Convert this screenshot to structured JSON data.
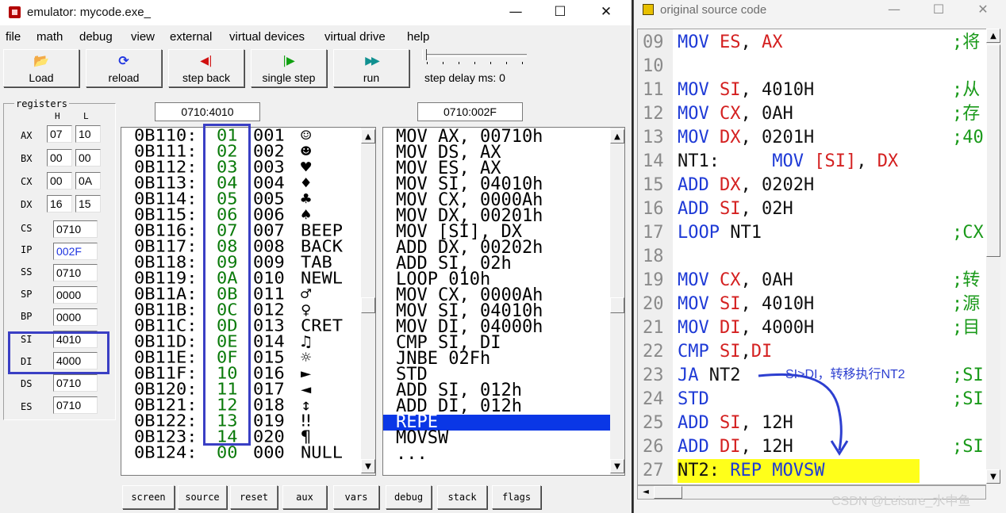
{
  "emulator": {
    "title": "emulator: mycode.exe_",
    "window_buttons": [
      "—",
      "☐",
      "✕"
    ],
    "menu": [
      "file",
      "math",
      "debug",
      "view",
      "external",
      "virtual devices",
      "virtual drive",
      "help"
    ],
    "toolbar": [
      {
        "label": "Load",
        "icon": "open-folder-icon",
        "glyph": "📂",
        "color": "#c08000"
      },
      {
        "label": "reload",
        "icon": "reload-icon",
        "glyph": "⟳",
        "color": "#1f35e0"
      },
      {
        "label": "step back",
        "icon": "step-back-icon",
        "glyph": "◀|",
        "color": "#d01010"
      },
      {
        "label": "single step",
        "icon": "single-step-icon",
        "glyph": "|▶",
        "color": "#10a010"
      },
      {
        "label": "run",
        "icon": "run-icon",
        "glyph": "▶▶",
        "color": "#109090"
      }
    ],
    "step_delay_label": "step delay ms: 0",
    "registers": {
      "title": "registers",
      "h_label": "H",
      "l_label": "L",
      "pairs": [
        {
          "name": "AX",
          "h": "07",
          "l": "10"
        },
        {
          "name": "BX",
          "h": "00",
          "l": "00"
        },
        {
          "name": "CX",
          "h": "00",
          "l": "0A"
        },
        {
          "name": "DX",
          "h": "16",
          "l": "15"
        }
      ],
      "singles": [
        {
          "name": "CS",
          "value": "0710"
        },
        {
          "name": "IP",
          "value": "002F",
          "highlight": true
        },
        {
          "name": "SS",
          "value": "0710"
        },
        {
          "name": "SP",
          "value": "0000"
        },
        {
          "name": "BP",
          "value": "0000"
        },
        {
          "name": "SI",
          "value": "4010"
        },
        {
          "name": "DI",
          "value": "4000"
        },
        {
          "name": "DS",
          "value": "0710"
        },
        {
          "name": "ES",
          "value": "0710"
        }
      ]
    },
    "memory_address": "0710:4010",
    "code_address": "0710:002F",
    "memory_rows": [
      {
        "addr": "0B110:",
        "hex": "01",
        "dec": "001",
        "chr": "☺"
      },
      {
        "addr": "0B111:",
        "hex": "02",
        "dec": "002",
        "chr": "☻"
      },
      {
        "addr": "0B112:",
        "hex": "03",
        "dec": "003",
        "chr": "♥"
      },
      {
        "addr": "0B113:",
        "hex": "04",
        "dec": "004",
        "chr": "♦"
      },
      {
        "addr": "0B114:",
        "hex": "05",
        "dec": "005",
        "chr": "♣"
      },
      {
        "addr": "0B115:",
        "hex": "06",
        "dec": "006",
        "chr": "♠"
      },
      {
        "addr": "0B116:",
        "hex": "07",
        "dec": "007",
        "chr": "BEEP"
      },
      {
        "addr": "0B117:",
        "hex": "08",
        "dec": "008",
        "chr": "BACK"
      },
      {
        "addr": "0B118:",
        "hex": "09",
        "dec": "009",
        "chr": "TAB"
      },
      {
        "addr": "0B119:",
        "hex": "0A",
        "dec": "010",
        "chr": "NEWL"
      },
      {
        "addr": "0B11A:",
        "hex": "0B",
        "dec": "011",
        "chr": "♂"
      },
      {
        "addr": "0B11B:",
        "hex": "0C",
        "dec": "012",
        "chr": "♀"
      },
      {
        "addr": "0B11C:",
        "hex": "0D",
        "dec": "013",
        "chr": "CRET"
      },
      {
        "addr": "0B11D:",
        "hex": "0E",
        "dec": "014",
        "chr": "♫"
      },
      {
        "addr": "0B11E:",
        "hex": "0F",
        "dec": "015",
        "chr": "☼"
      },
      {
        "addr": "0B11F:",
        "hex": "10",
        "dec": "016",
        "chr": "►"
      },
      {
        "addr": "0B120:",
        "hex": "11",
        "dec": "017",
        "chr": "◄"
      },
      {
        "addr": "0B121:",
        "hex": "12",
        "dec": "018",
        "chr": "↕"
      },
      {
        "addr": "0B122:",
        "hex": "13",
        "dec": "019",
        "chr": "‼"
      },
      {
        "addr": "0B123:",
        "hex": "14",
        "dec": "020",
        "chr": "¶"
      },
      {
        "addr": "0B124:",
        "hex": "00",
        "dec": "000",
        "chr": "NULL"
      }
    ],
    "disassembly": [
      {
        "text": "MOV AX, 00710h"
      },
      {
        "text": "MOV DS, AX"
      },
      {
        "text": "MOV ES, AX"
      },
      {
        "text": "MOV SI, 04010h"
      },
      {
        "text": "MOV CX, 0000Ah"
      },
      {
        "text": "MOV DX, 00201h"
      },
      {
        "text": "MOV [SI], DX"
      },
      {
        "text": "ADD DX, 00202h"
      },
      {
        "text": "ADD SI, 02h"
      },
      {
        "text": "LOOP 010h"
      },
      {
        "text": "MOV CX, 0000Ah"
      },
      {
        "text": "MOV SI, 04010h"
      },
      {
        "text": "MOV DI, 04000h"
      },
      {
        "text": "CMP SI, DI"
      },
      {
        "text": "JNBE 02Fh"
      },
      {
        "text": "STD"
      },
      {
        "text": "ADD SI, 012h"
      },
      {
        "text": "ADD DI, 012h"
      },
      {
        "text": "REPE",
        "selected": true
      },
      {
        "text": "MOVSW"
      },
      {
        "text": "..."
      }
    ],
    "bottom_buttons": [
      "screen",
      "source",
      "reset",
      "aux",
      "vars",
      "debug",
      "stack",
      "flags"
    ]
  },
  "source": {
    "title": "original source code",
    "window_buttons": [
      "—",
      "☐",
      "✕"
    ],
    "lines": [
      {
        "ln": "09",
        "parts": [
          [
            "kw",
            "MOV "
          ],
          [
            "reg",
            "ES"
          ],
          [
            "num",
            ", "
          ],
          [
            "reg",
            "AX"
          ]
        ],
        "comment": ";将"
      },
      {
        "ln": "10",
        "parts": [],
        "comment": ""
      },
      {
        "ln": "11",
        "parts": [
          [
            "kw",
            "MOV "
          ],
          [
            "reg",
            "SI"
          ],
          [
            "num",
            ", 4010H"
          ]
        ],
        "comment": ";从"
      },
      {
        "ln": "12",
        "parts": [
          [
            "kw",
            "MOV "
          ],
          [
            "reg",
            "CX"
          ],
          [
            "num",
            ", 0AH"
          ]
        ],
        "comment": ";存"
      },
      {
        "ln": "13",
        "parts": [
          [
            "kw",
            "MOV "
          ],
          [
            "reg",
            "DX"
          ],
          [
            "num",
            ", 0201H"
          ]
        ],
        "comment": ";40"
      },
      {
        "ln": "14",
        "parts": [
          [
            "lbl2",
            "NT1:     "
          ],
          [
            "kw",
            "MOV "
          ],
          [
            "reg",
            "[SI]"
          ],
          [
            "num",
            ", "
          ],
          [
            "reg",
            "DX"
          ]
        ],
        "comment": ""
      },
      {
        "ln": "15",
        "parts": [
          [
            "kw",
            "ADD "
          ],
          [
            "reg",
            "DX"
          ],
          [
            "num",
            ", 0202H"
          ]
        ],
        "comment": ""
      },
      {
        "ln": "16",
        "parts": [
          [
            "kw",
            "ADD "
          ],
          [
            "reg",
            "SI"
          ],
          [
            "num",
            ", 02H"
          ]
        ],
        "comment": ""
      },
      {
        "ln": "17",
        "parts": [
          [
            "kw",
            "LOOP "
          ],
          [
            "lbl2",
            "NT1"
          ]
        ],
        "comment": ";CX"
      },
      {
        "ln": "18",
        "parts": [],
        "comment": ""
      },
      {
        "ln": "19",
        "parts": [
          [
            "kw",
            "MOV "
          ],
          [
            "reg",
            "CX"
          ],
          [
            "num",
            ", 0AH"
          ]
        ],
        "comment": ";转"
      },
      {
        "ln": "20",
        "parts": [
          [
            "kw",
            "MOV "
          ],
          [
            "reg",
            "SI"
          ],
          [
            "num",
            ", 4010H"
          ]
        ],
        "comment": ";源"
      },
      {
        "ln": "21",
        "parts": [
          [
            "kw",
            "MOV "
          ],
          [
            "reg",
            "DI"
          ],
          [
            "num",
            ", 4000H"
          ]
        ],
        "comment": ";目"
      },
      {
        "ln": "22",
        "parts": [
          [
            "kw",
            "CMP "
          ],
          [
            "reg",
            "SI"
          ],
          [
            "num",
            ","
          ],
          [
            "reg",
            "DI"
          ]
        ],
        "comment": ""
      },
      {
        "ln": "23",
        "parts": [
          [
            "kw",
            "JA "
          ],
          [
            "lbl2",
            "NT2"
          ]
        ],
        "comment": ";SI"
      },
      {
        "ln": "24",
        "parts": [
          [
            "kw",
            "STD"
          ]
        ],
        "comment": ";SI"
      },
      {
        "ln": "25",
        "parts": [
          [
            "kw",
            "ADD "
          ],
          [
            "reg",
            "SI"
          ],
          [
            "num",
            ", 12H"
          ]
        ],
        "comment": ""
      },
      {
        "ln": "26",
        "parts": [
          [
            "kw",
            "ADD "
          ],
          [
            "reg",
            "DI"
          ],
          [
            "num",
            ", 12H"
          ]
        ],
        "comment": ";SI"
      },
      {
        "ln": "27",
        "parts": [
          [
            "lbl2",
            "NT2: "
          ],
          [
            "kw",
            "REP MOVSW"
          ]
        ],
        "comment": "",
        "highlight": true
      }
    ]
  },
  "annotation": {
    "text": "SI>DI，转移执行NT2",
    "color": "#2d3fd0"
  },
  "watermark": "CSDN @Leisure_水中鱼"
}
